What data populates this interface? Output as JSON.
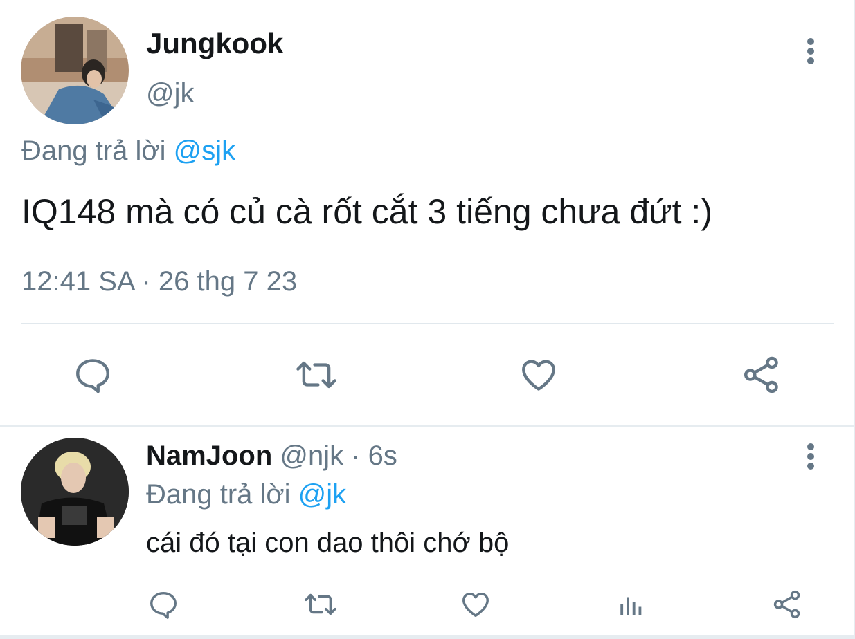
{
  "main_tweet": {
    "avatar_icon": "user-avatar-photo",
    "display_name": "Jungkook",
    "handle": "@jk",
    "replying_prefix": "Đang trả lời",
    "replying_to": "@sjk",
    "text": "IQ148 mà có củ cà rốt cắt 3 tiếng chưa đứt :)",
    "timestamp": "12:41 SA · 26 thg 7 23",
    "more_icon": "more-vertical-icon",
    "actions": [
      "reply-icon",
      "retweet-icon",
      "like-icon",
      "share-icon"
    ]
  },
  "reply_tweet": {
    "avatar_icon": "user-avatar-photo",
    "display_name": "NamJoon",
    "handle": "@njk",
    "separator": " · ",
    "time_ago": "6s",
    "replying_prefix": "Đang trả lời",
    "replying_to": "@jk",
    "text": "cái đó tại con dao thôi chớ bộ",
    "more_icon": "more-vertical-icon",
    "actions": [
      "reply-icon",
      "retweet-icon",
      "like-icon",
      "analytics-icon",
      "share-icon"
    ]
  },
  "colors": {
    "text_primary": "#14171a",
    "text_secondary": "#657786",
    "mention": "#1da1f2",
    "divider": "#e1e8ed",
    "icon": "#657786"
  }
}
